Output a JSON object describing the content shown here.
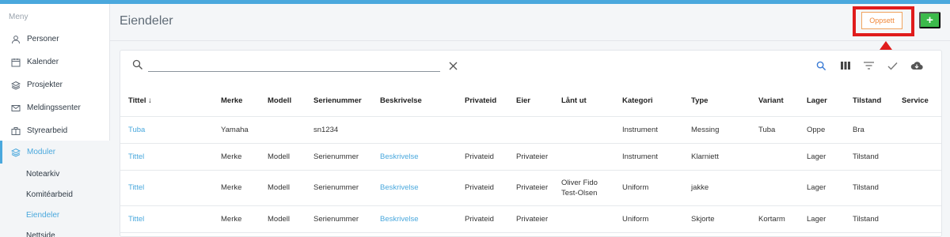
{
  "sidebar": {
    "menu_title": "Meny",
    "items": [
      {
        "label": "Personer",
        "icon": "user-icon"
      },
      {
        "label": "Kalender",
        "icon": "calendar-icon"
      },
      {
        "label": "Prosjekter",
        "icon": "layers-icon"
      },
      {
        "label": "Meldingssenter",
        "icon": "envelope-icon"
      },
      {
        "label": "Styrearbeid",
        "icon": "briefcase-icon"
      },
      {
        "label": "Moduler",
        "icon": "layers-icon"
      }
    ],
    "sub_items": [
      {
        "label": "Notearkiv"
      },
      {
        "label": "Komitéarbeid"
      },
      {
        "label": "Eiendeler"
      },
      {
        "label": "Nettside"
      }
    ]
  },
  "header": {
    "title": "Eiendeler",
    "oppsett_label": "Oppsett",
    "add_label": "+"
  },
  "search": {
    "value": "",
    "placeholder": ""
  },
  "toolbar": {
    "icons": [
      "search-icon",
      "columns-icon",
      "filter-icon",
      "check-icon",
      "cloud-download-icon"
    ]
  },
  "table": {
    "sort_indicator": "↓",
    "columns": [
      "Tittel",
      "Merke",
      "Modell",
      "Serienummer",
      "Beskrivelse",
      "Privateid",
      "Eier",
      "Lånt ut",
      "Kategori",
      "Type",
      "Variant",
      "Lager",
      "Tilstand",
      "Service"
    ],
    "rows": [
      {
        "tittel": "Tuba",
        "merke": "Yamaha",
        "modell": "",
        "serienummer": "sn1234",
        "beskrivelse": "",
        "privateid": "",
        "eier": "",
        "lant_ut_1": "",
        "lant_ut_2": "",
        "kategori": "Instrument",
        "type": "Messing",
        "variant": "Tuba",
        "lager": "Oppe",
        "tilstand": "Bra",
        "service": ""
      },
      {
        "tittel": "Tittel",
        "merke": "Merke",
        "modell": "Modell",
        "serienummer": "Serienummer",
        "beskrivelse": "Beskrivelse",
        "privateid": "Privateid",
        "eier": "Privateier",
        "lant_ut_1": "",
        "lant_ut_2": "",
        "kategori": "Instrument",
        "type": "Klarniett",
        "variant": "",
        "lager": "Lager",
        "tilstand": "Tilstand",
        "service": ""
      },
      {
        "tittel": "Tittel",
        "merke": "Merke",
        "modell": "Modell",
        "serienummer": "Serienummer",
        "beskrivelse": "Beskrivelse",
        "privateid": "Privateid",
        "eier": "Privateier",
        "lant_ut_1": "Oliver Fido",
        "lant_ut_2": "Test-Olsen",
        "kategori": "Uniform",
        "type": "jakke",
        "variant": "",
        "lager": "Lager",
        "tilstand": "Tilstand",
        "service": ""
      },
      {
        "tittel": "Tittel",
        "merke": "Merke",
        "modell": "Modell",
        "serienummer": "Serienummer",
        "beskrivelse": "Beskrivelse",
        "privateid": "Privateid",
        "eier": "Privateier",
        "lant_ut_1": "",
        "lant_ut_2": "",
        "kategori": "Uniform",
        "type": "Skjorte",
        "variant": "Kortarm",
        "lager": "Lager",
        "tilstand": "Tilstand",
        "service": ""
      }
    ]
  },
  "colors": {
    "accent": "#4aa8dd",
    "highlight_red": "#e01c1c",
    "oppsett_orange": "#f0883a",
    "add_green": "#3cba4b"
  }
}
